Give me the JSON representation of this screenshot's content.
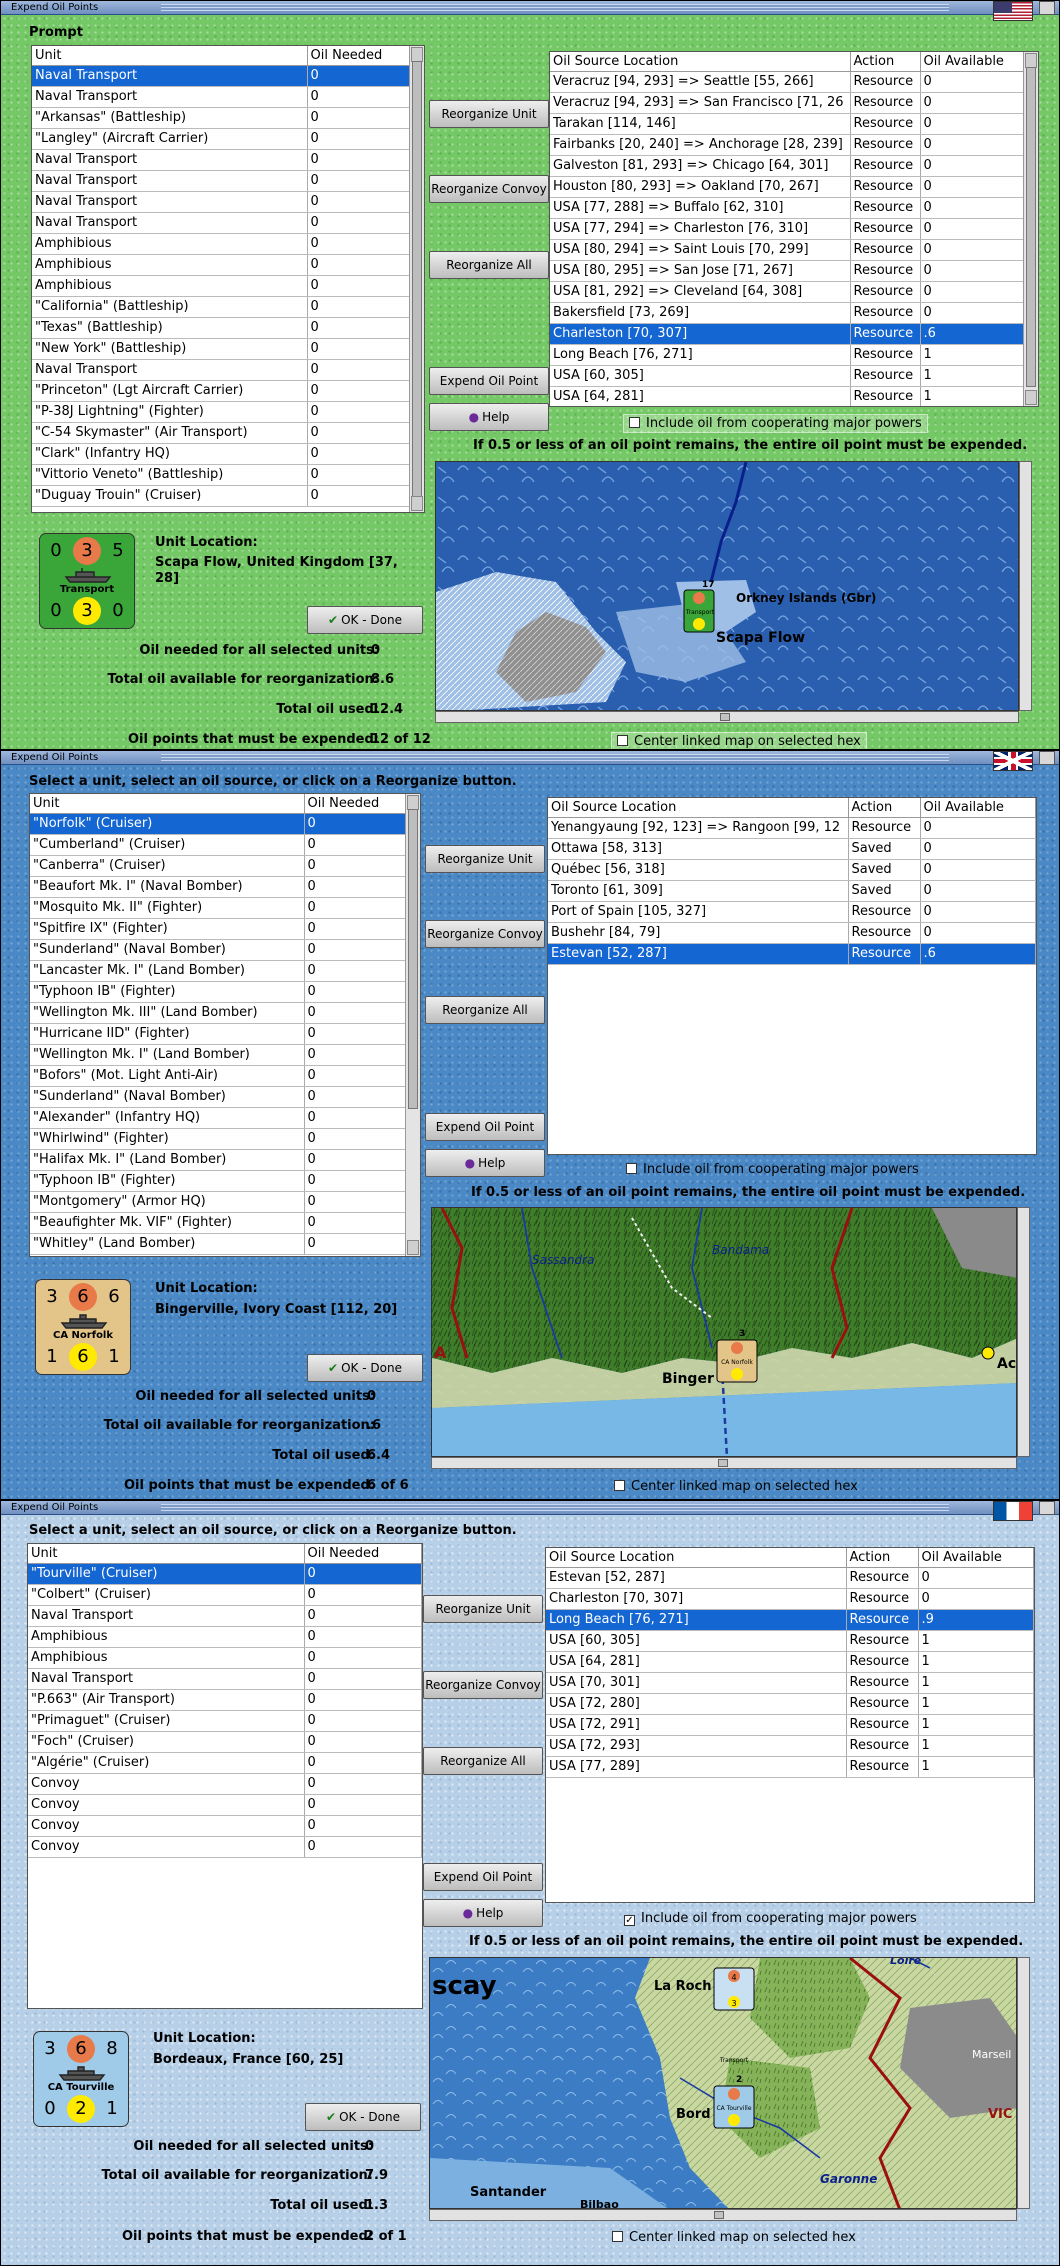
{
  "panels": [
    {
      "window_title": "Expend Oil Points",
      "instruction": "Prompt",
      "unit_grid": {
        "headers": [
          "Unit",
          "Oil Needed"
        ],
        "rows": [
          [
            "Naval Transport",
            "0"
          ],
          [
            "Naval Transport",
            "0"
          ],
          [
            "\"Arkansas\" (Battleship)",
            "0"
          ],
          [
            "\"Langley\" (Aircraft Carrier)",
            "0"
          ],
          [
            "Naval Transport",
            "0"
          ],
          [
            "Naval Transport",
            "0"
          ],
          [
            "Naval Transport",
            "0"
          ],
          [
            "Naval Transport",
            "0"
          ],
          [
            "Amphibious",
            "0"
          ],
          [
            "Amphibious",
            "0"
          ],
          [
            "Amphibious",
            "0"
          ],
          [
            "\"California\" (Battleship)",
            "0"
          ],
          [
            "\"Texas\" (Battleship)",
            "0"
          ],
          [
            "\"New York\" (Battleship)",
            "0"
          ],
          [
            "Naval Transport",
            "0"
          ],
          [
            "\"Princeton\" (Lgt Aircraft Carrier)",
            "0"
          ],
          [
            "\"P-38J Lightning\" (Fighter)",
            "0"
          ],
          [
            "\"C-54 Skymaster\" (Air Transport)",
            "0"
          ],
          [
            "\"Clark\" (Infantry HQ)",
            "0"
          ],
          [
            "\"Vittorio Veneto\" (Battleship)",
            "0"
          ],
          [
            "\"Duguay Trouin\" (Cruiser)",
            "0"
          ]
        ],
        "selected": 0
      },
      "buttons": {
        "reorganize_unit": "Reorganize Unit",
        "reorganize_convoy": "Reorganize Convoy",
        "reorganize_all": "Reorganize All",
        "expend_oil_point": "Expend Oil Point",
        "help": "Help",
        "ok_done": "OK - Done"
      },
      "source_grid": {
        "headers": [
          "Oil Source Location",
          "Action",
          "Oil Available"
        ],
        "rows": [
          [
            "Veracruz [94, 293] => Seattle [55, 266]",
            "Resource",
            "0"
          ],
          [
            "Veracruz [94, 293] => San Francisco [71, 26",
            "Resource",
            "0"
          ],
          [
            "Tarakan [114, 146]",
            "Resource",
            "0"
          ],
          [
            "Fairbanks [20, 240] => Anchorage [28, 239]",
            "Resource",
            "0"
          ],
          [
            "Galveston [81, 293] => Chicago [64, 301]",
            "Resource",
            "0"
          ],
          [
            "Houston [80, 293] => Oakland [70, 267]",
            "Resource",
            "0"
          ],
          [
            "USA [77, 288] => Buffalo [62, 310]",
            "Resource",
            "0"
          ],
          [
            "USA [77, 294] => Charleston [76, 310]",
            "Resource",
            "0"
          ],
          [
            "USA [80, 294] => Saint Louis [70, 299]",
            "Resource",
            "0"
          ],
          [
            "USA [80, 295] => San Jose [71, 267]",
            "Resource",
            "0"
          ],
          [
            "USA [81, 292] => Cleveland [64, 308]",
            "Resource",
            "0"
          ],
          [
            "Bakersfield [73, 269]",
            "Resource",
            "0"
          ],
          [
            "Charleston [70, 307]",
            "Resource",
            ".6"
          ],
          [
            "Long Beach [76, 271]",
            "Resource",
            "1"
          ],
          [
            "USA [60, 305]",
            "Resource",
            "1"
          ],
          [
            "USA [64, 281]",
            "Resource",
            "1"
          ]
        ],
        "selected": 12
      },
      "include_cooperating": {
        "label": "Include oil from cooperating major powers",
        "checked": false
      },
      "rule_note": "If 0.5 or less of an oil point remains, the entire oil point must be expended.",
      "center_map": {
        "label": "Center linked map on selected hex",
        "checked": false
      },
      "counter": {
        "top_left": "0",
        "top_circle": "3",
        "top_right": "5",
        "name": "Transport",
        "bottom_left": "0",
        "bottom_circle": "3",
        "bottom_right": "0",
        "color": "#3aa63a",
        "circle_color": "#e87a4a"
      },
      "unit_location_label": "Unit Location:",
      "unit_location": "Scapa Flow, United Kingdom [37, 28]",
      "stats": [
        {
          "label": "Oil needed for all selected units:",
          "value": "0"
        },
        {
          "label": "Total oil available for reorganization:",
          "value": "8.6"
        },
        {
          "label": "Total oil used:",
          "value": "12.4"
        },
        {
          "label": "Oil points that must be expended:",
          "value": "12 of 12"
        }
      ],
      "map_labels": {
        "island": "Orkney Islands (Gbr)",
        "place": "Scapa Flow",
        "stack": "17",
        "counter_name": "Transport"
      }
    },
    {
      "window_title": "Expend Oil Points",
      "instruction": "Select a unit, select an oil source, or click on a Reorganize button.",
      "unit_grid": {
        "headers": [
          "Unit",
          "Oil Needed"
        ],
        "rows": [
          [
            "\"Norfolk\" (Cruiser)",
            "0"
          ],
          [
            "\"Cumberland\" (Cruiser)",
            "0"
          ],
          [
            "\"Canberra\" (Cruiser)",
            "0"
          ],
          [
            "\"Beaufort Mk. I\" (Naval Bomber)",
            "0"
          ],
          [
            "\"Mosquito Mk. II\" (Fighter)",
            "0"
          ],
          [
            "\"Spitfire IX\" (Fighter)",
            "0"
          ],
          [
            "\"Sunderland\" (Naval Bomber)",
            "0"
          ],
          [
            "\"Lancaster Mk. I\" (Land Bomber)",
            "0"
          ],
          [
            "\"Typhoon IB\" (Fighter)",
            "0"
          ],
          [
            "\"Wellington Mk. III\" (Land Bomber)",
            "0"
          ],
          [
            "\"Hurricane IID\" (Fighter)",
            "0"
          ],
          [
            "\"Wellington Mk. I\" (Land Bomber)",
            "0"
          ],
          [
            "\"Bofors\" (Mot. Light Anti-Air)",
            "0"
          ],
          [
            "\"Sunderland\" (Naval Bomber)",
            "0"
          ],
          [
            "\"Alexander\" (Infantry HQ)",
            "0"
          ],
          [
            "\"Whirlwind\" (Fighter)",
            "0"
          ],
          [
            "\"Halifax Mk. I\" (Land Bomber)",
            "0"
          ],
          [
            "\"Typhoon IB\" (Fighter)",
            "0"
          ],
          [
            "\"Montgomery\" (Armor HQ)",
            "0"
          ],
          [
            "\"Beaufighter Mk. VIF\" (Fighter)",
            "0"
          ],
          [
            "\"Whitley\" (Land Bomber)",
            "0"
          ]
        ],
        "selected": 0
      },
      "buttons": {
        "reorganize_unit": "Reorganize Unit",
        "reorganize_convoy": "Reorganize Convoy",
        "reorganize_all": "Reorganize All",
        "expend_oil_point": "Expend Oil Point",
        "help": "Help",
        "ok_done": "OK - Done"
      },
      "source_grid": {
        "headers": [
          "Oil Source Location",
          "Action",
          "Oil Available"
        ],
        "rows": [
          [
            "Yenangyaung [92, 123] => Rangoon [99, 12",
            "Resource",
            "0"
          ],
          [
            "Ottawa [58, 313]",
            "Saved",
            "0"
          ],
          [
            "Québec [56, 318]",
            "Saved",
            "0"
          ],
          [
            "Toronto [61, 309]",
            "Saved",
            "0"
          ],
          [
            "Port of Spain [105, 327]",
            "Resource",
            "0"
          ],
          [
            "Bushehr [84, 79]",
            "Resource",
            "0"
          ],
          [
            "Estevan [52, 287]",
            "Resource",
            ".6"
          ]
        ],
        "selected": 6
      },
      "include_cooperating": {
        "label": "Include oil from cooperating major powers",
        "checked": false
      },
      "rule_note": "If 0.5 or less of an oil point remains, the entire oil point must be expended.",
      "center_map": {
        "label": "Center linked map on selected hex",
        "checked": false
      },
      "counter": {
        "top_left": "3",
        "top_circle": "6",
        "top_right": "6",
        "name": "CA Norfolk",
        "bottom_left": "1",
        "bottom_circle": "6",
        "bottom_right": "1",
        "color": "#e3c489",
        "circle_color": "#e87a4a"
      },
      "unit_location_label": "Unit Location:",
      "unit_location": "Bingerville, Ivory Coast [112, 20]",
      "stats": [
        {
          "label": "Oil needed for all selected units:",
          "value": "0"
        },
        {
          "label": "Total oil available for reorganization:",
          "value": ".6"
        },
        {
          "label": "Total oil used:",
          "value": "6.4"
        },
        {
          "label": "Oil points that must be expended:",
          "value": "6 of 6"
        }
      ],
      "map_labels": {
        "river1": "Sassandra",
        "river2": "Bandama",
        "place": "Binger",
        "letter": "A",
        "edge": "Ac",
        "stack": "3",
        "counter_name": "CA Norfolk"
      }
    },
    {
      "window_title": "Expend Oil Points",
      "instruction": "Select a unit, select an oil source, or click on a Reorganize button.",
      "unit_grid": {
        "headers": [
          "Unit",
          "Oil Needed"
        ],
        "rows": [
          [
            "\"Tourville\" (Cruiser)",
            "0"
          ],
          [
            "\"Colbert\" (Cruiser)",
            "0"
          ],
          [
            "Naval Transport",
            "0"
          ],
          [
            "Amphibious",
            "0"
          ],
          [
            "Amphibious",
            "0"
          ],
          [
            "Naval Transport",
            "0"
          ],
          [
            "\"P.663\" (Air Transport)",
            "0"
          ],
          [
            "\"Primaguet\" (Cruiser)",
            "0"
          ],
          [
            "\"Foch\" (Cruiser)",
            "0"
          ],
          [
            "\"Algérie\" (Cruiser)",
            "0"
          ],
          [
            "Convoy",
            "0"
          ],
          [
            "Convoy",
            "0"
          ],
          [
            "Convoy",
            "0"
          ],
          [
            "Convoy",
            "0"
          ]
        ],
        "selected": 0
      },
      "buttons": {
        "reorganize_unit": "Reorganize Unit",
        "reorganize_convoy": "Reorganize Convoy",
        "reorganize_all": "Reorganize All",
        "expend_oil_point": "Expend Oil Point",
        "help": "Help",
        "ok_done": "OK - Done"
      },
      "source_grid": {
        "headers": [
          "Oil Source Location",
          "Action",
          "Oil Available"
        ],
        "rows": [
          [
            "Estevan [52, 287]",
            "Resource",
            "0"
          ],
          [
            "Charleston [70, 307]",
            "Resource",
            "0"
          ],
          [
            "Long Beach [76, 271]",
            "Resource",
            ".9"
          ],
          [
            "USA [60, 305]",
            "Resource",
            "1"
          ],
          [
            "USA [64, 281]",
            "Resource",
            "1"
          ],
          [
            "USA [70, 301]",
            "Resource",
            "1"
          ],
          [
            "USA [72, 280]",
            "Resource",
            "1"
          ],
          [
            "USA [72, 291]",
            "Resource",
            "1"
          ],
          [
            "USA [72, 293]",
            "Resource",
            "1"
          ],
          [
            "USA [77, 289]",
            "Resource",
            "1"
          ]
        ],
        "selected": 2
      },
      "include_cooperating": {
        "label": "Include oil from cooperating major powers",
        "checked": true
      },
      "rule_note": "If 0.5 or less of an oil point remains, the entire oil point must be expended.",
      "center_map": {
        "label": "Center linked map on selected hex",
        "checked": false
      },
      "counter": {
        "top_left": "3",
        "top_circle": "6",
        "top_right": "8",
        "name": "CA Tourville",
        "bottom_left": "0",
        "bottom_circle": "2",
        "bottom_right": "1",
        "color": "#9fcbe8",
        "circle_color": "#e87a4a"
      },
      "unit_location_label": "Unit Location:",
      "unit_location": "Bordeaux, France [60, 25]",
      "stats": [
        {
          "label": "Oil needed for all selected units:",
          "value": "0"
        },
        {
          "label": "Total oil available for reorganization:",
          "value": "7.9"
        },
        {
          "label": "Total oil used:",
          "value": "1.3"
        },
        {
          "label": "Oil points that must be expended:",
          "value": "2 of 1"
        }
      ],
      "map_labels": {
        "sea": "scay",
        "place1": "La Roch",
        "place2": "Bord",
        "place3": "Santander",
        "place4": "Bilbao",
        "river1": "Garonne",
        "river2": "Loire",
        "place5": "Marseil",
        "place6": "VIC",
        "stack": "2",
        "counter_name": "CA Tourville",
        "counter_name2": "Transport",
        "counter2_top": "4",
        "counter2_bottom": "3"
      }
    }
  ]
}
